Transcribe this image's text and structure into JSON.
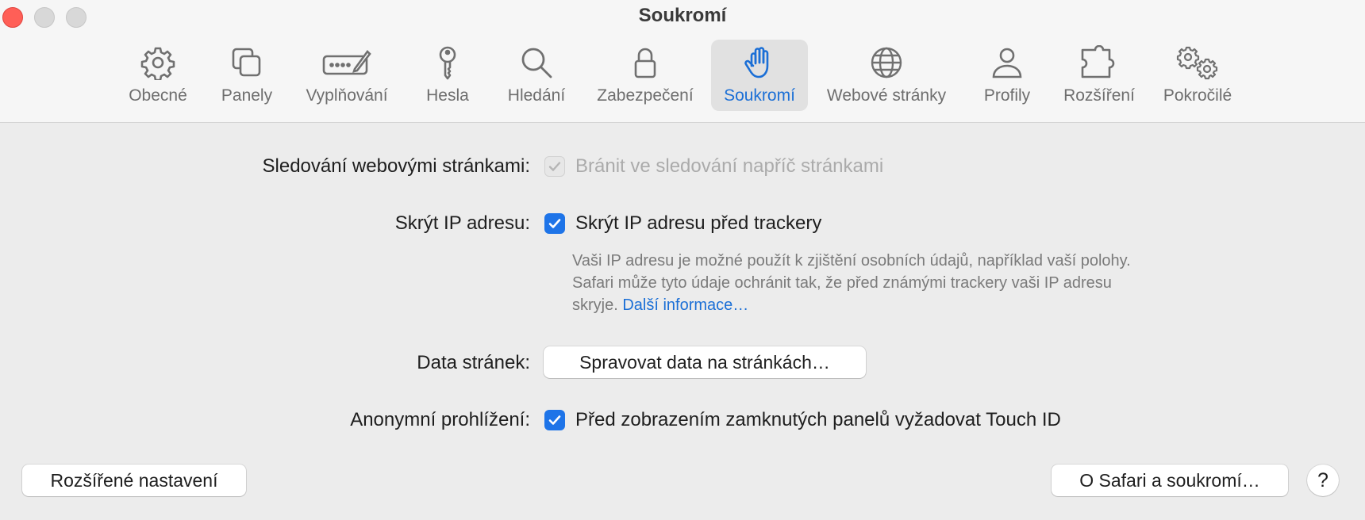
{
  "window": {
    "title": "Soukromí"
  },
  "toolbar": {
    "tabs": [
      {
        "label": "Obecné",
        "icon": "gear-icon"
      },
      {
        "label": "Panely",
        "icon": "tabs-icon"
      },
      {
        "label": "Vyplňování",
        "icon": "autofill-icon"
      },
      {
        "label": "Hesla",
        "icon": "key-icon"
      },
      {
        "label": "Hledání",
        "icon": "search-icon"
      },
      {
        "label": "Zabezpečení",
        "icon": "lock-icon"
      },
      {
        "label": "Soukromí",
        "icon": "hand-icon",
        "active": true
      },
      {
        "label": "Webové stránky",
        "icon": "globe-icon"
      },
      {
        "label": "Profily",
        "icon": "person-icon"
      },
      {
        "label": "Rozšíření",
        "icon": "puzzle-icon"
      },
      {
        "label": "Pokročilé",
        "icon": "gears-icon"
      }
    ]
  },
  "settings": {
    "tracking": {
      "label": "Sledování webovými stránkami:",
      "option": "Bránit ve sledování napříč stránkami",
      "checked": true,
      "disabled": true
    },
    "hide_ip": {
      "label": "Skrýt IP adresu:",
      "option": "Skrýt IP adresu před trackery",
      "checked": true,
      "description": "Vaši IP adresu je možné použít k zjištění osobních údajů, například vaší polohy. Safari může tyto údaje ochránit tak, že před známými trackery vaši IP adresu skryje.",
      "link": "Další informace…"
    },
    "site_data": {
      "label": "Data stránek:",
      "button": "Spravovat data na stránkách…"
    },
    "private_browsing": {
      "label": "Anonymní prohlížení:",
      "option": "Před zobrazením zamknutých panelů vyžadovat Touch ID",
      "checked": true
    }
  },
  "footer": {
    "advanced_button": "Rozšířené nastavení",
    "about_button": "O Safari a soukromí…",
    "help_button": "?"
  },
  "colors": {
    "accent": "#1e74e8",
    "active_tab_text": "#1b6fd6",
    "close": "#ff5f57"
  }
}
